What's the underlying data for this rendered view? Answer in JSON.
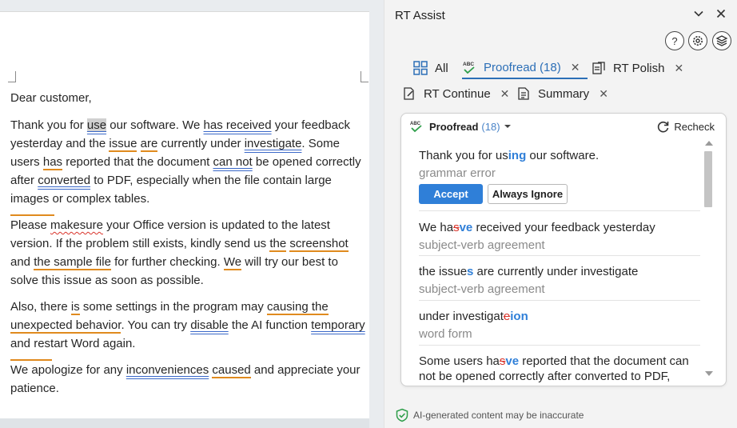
{
  "document": {
    "greeting": "Dear customer,",
    "p1": {
      "t1": "Thank you for ",
      "w1": "use",
      "t2": " our software. We ",
      "w2": "has received",
      "t3": " your feedback yesterday and the ",
      "w3": "issue",
      "t4": " ",
      "w4": "are",
      "t5": " currently under ",
      "w5": "investigate",
      "t6": ". Some users ",
      "w6": "has",
      "t7": " reported that the document ",
      "w7": "can not",
      "t8": " be opened correctly after ",
      "w8": "converted",
      "t9": " to PDF, especially when the file contain large images or complex tables."
    },
    "p2": {
      "t1": "Please ",
      "w1": "makesure",
      "t2": " your Office version is updated to the latest version. If the problem still exists, kindly send us ",
      "w2": "the",
      "t3": " ",
      "w3": "screenshot",
      "t4": " and ",
      "w4": "the sample file",
      "t5": " for further checking. ",
      "w5": "We",
      "t6": " will try our best to solve this issue as soon as possible."
    },
    "p3": {
      "t1": "Also, there ",
      "w1": "is",
      "t2": " some settings in the program may ",
      "w2": "causing the",
      "t3": " ",
      "w3": "unexpected behavior",
      "t4": ". You can try ",
      "w4": "disable",
      "t5": " the AI function ",
      "w5": "temporary",
      "t6": " and restart Word again."
    },
    "p4": {
      "t1": "We apologize for any ",
      "w1": "inconveniences",
      "t2": " ",
      "w2": "caused",
      "t3": " and appreciate your patience."
    }
  },
  "panel": {
    "title": "RT Assist",
    "tabs": {
      "all": "All",
      "proofread": "Proofread (18)",
      "polish": "RT Polish",
      "continue": "RT Continue",
      "summary": "Summary"
    },
    "card": {
      "title": "Proofread",
      "count": "(18)",
      "recheck": "Recheck",
      "accept": "Accept",
      "ignore": "Always Ignore",
      "issues": [
        {
          "pre": "Thank you for us",
          "ins": "ing",
          "post": " our software.",
          "type": "grammar error"
        },
        {
          "pre": "We ha",
          "del": "s",
          "ins": "ve",
          "post": " received your feedback yesterday",
          "type": "subject-verb agreement"
        },
        {
          "pre": "the issue",
          "ins": "s",
          "post": " are currently under investigate",
          "type": "subject-verb agreement"
        },
        {
          "pre": "under investigat",
          "del": "e",
          "ins": "ion",
          "post": "",
          "type": "word form"
        },
        {
          "pre": "Some users ha",
          "del": "s",
          "ins": "ve",
          "post": " reported that the document can not be opened correctly after converted to PDF,",
          "type": ""
        }
      ]
    },
    "disclaimer": "AI-generated content may be inaccurate"
  },
  "colors": {
    "accent": "#2f7fd8",
    "tab_active": "#2c6fb7",
    "error_orange": "#e08a1e",
    "error_red": "#d9342b"
  }
}
